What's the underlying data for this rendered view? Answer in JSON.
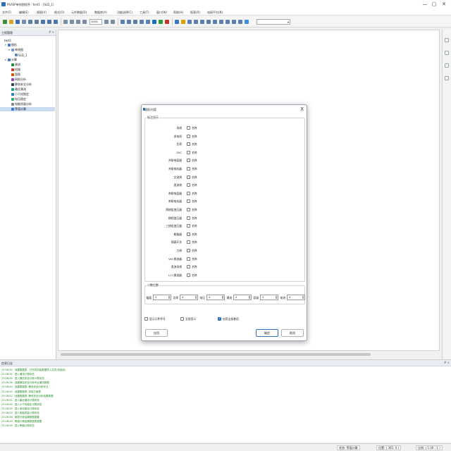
{
  "window": {
    "title": "PSASP单线图程序 - test1 - [SLD_1]",
    "controls": [
      "—",
      "▢",
      "✕"
    ]
  },
  "menu": [
    "文件(F)",
    "编辑(E)",
    "视图(V)",
    "格式(O)",
    "元件数据(D)",
    "数据库(A)",
    "功能选择(C)",
    "工具(T)",
    "窗口(W)",
    "帮助(H)",
    "报表(R)",
    "电网平台(N)"
  ],
  "toolbar": {
    "zoom": "100%"
  },
  "left_panel": {
    "title": "工程管理",
    "pin": "# ×",
    "tree": [
      {
        "label": "test1",
        "level": 0,
        "toggle": "",
        "icon": ""
      },
      {
        "label": "图形",
        "level": 1,
        "toggle": "▾",
        "icon": "#3a7bd5"
      },
      {
        "label": "单线图",
        "level": 2,
        "toggle": "▾",
        "icon": "#6c9bd2"
      },
      {
        "label": "SLD_1",
        "level": 3,
        "toggle": "",
        "icon": "#5a86b8"
      },
      {
        "label": "计算",
        "level": 1,
        "toggle": "▾",
        "icon": "#3a7bd5"
      },
      {
        "label": "潮流",
        "level": 2,
        "toggle": "",
        "icon": "#1c8f3a"
      },
      {
        "label": "短路",
        "level": 2,
        "toggle": "",
        "icon": "#c0392b"
      },
      {
        "label": "暂稳",
        "level": 2,
        "toggle": "",
        "icon": "#d35400"
      },
      {
        "label": "网损分析",
        "level": 2,
        "toggle": "",
        "icon": "#8e44ad"
      },
      {
        "label": "静态安全分析",
        "level": 2,
        "toggle": "",
        "icon": "#2c3e50"
      },
      {
        "label": "最优潮流",
        "level": 2,
        "toggle": "",
        "icon": "#16a085"
      },
      {
        "label": "小干扰稳定",
        "level": 2,
        "toggle": "",
        "icon": "#2980b9"
      },
      {
        "label": "电压稳定",
        "level": 2,
        "toggle": "",
        "icon": "#27ae60"
      },
      {
        "label": "电能质量分析",
        "level": 2,
        "toggle": "",
        "icon": "#7f8c8d"
      },
      {
        "label": "等值计算",
        "level": 2,
        "toggle": "",
        "icon": "#3a7bd5",
        "selected": true
      }
    ]
  },
  "bottom_panel": {
    "title": "信息日志",
    "pin": "# ×",
    "lines": [
      {
        "time": "23:26:30",
        "msg": "创建数据表 - 已先将初始数据导入文件(初始化)"
      },
      {
        "time": "23:26:32",
        "msg": "进入潮流计算状态"
      },
      {
        "time": "23:26:35",
        "msg": "进入静态安全分析计算状态"
      },
      {
        "time": "23:26:38",
        "msg": "创建静态安全分析专业潮流数据"
      },
      {
        "time": "23:26:40",
        "msg": "创建数据表: 静态安全分析作业"
      },
      {
        "time": "23:26:40",
        "msg": "创建数据表: 切除方案表"
      },
      {
        "time": "23:26:40",
        "msg": "创建数据表: 静态安全分析结果数据"
      },
      {
        "time": "23:26:41",
        "msg": "进入最优潮流计算状态"
      },
      {
        "time": "23:26:44",
        "msg": "进入小干扰稳定计算状态"
      },
      {
        "time": "23:26:45",
        "msg": "进入电压稳定计算状态"
      },
      {
        "time": "23:26:45",
        "msg": "进入电能质量计算状态"
      },
      {
        "time": "23:26:46",
        "msg": "网损分析结果数据重置"
      },
      {
        "time": "23:26:49",
        "msg": "等值计算结果数据表重置"
      },
      {
        "time": "23:26:49",
        "msg": "进入等值计算状态"
      }
    ]
  },
  "status_bar": {
    "state": "状态: 等值计算",
    "position": "位置: ( 365, 0 )",
    "scale": "比例: ( 1.00 : 1 )"
  },
  "dialog": {
    "title": "图形内容",
    "close": "X",
    "group_label": "标注显示",
    "checkbox_text": "名称",
    "rows": [
      "母线",
      "发电机",
      "负荷",
      "SVC",
      "并联电容器",
      "并联电抗器",
      "交流线",
      "直流线",
      "串联电容器",
      "串联电抗器",
      "两绕组变压器",
      "移相变压器",
      "三绕组变压器",
      "断路器",
      "隔离开关",
      "刀闸",
      "VSC换流器",
      "直流母线",
      "LCC换流器"
    ],
    "decimal_group_label": "小数位数",
    "decimals": [
      {
        "label": "幅值",
        "value": "4"
      },
      {
        "label": "功率",
        "value": "4"
      },
      {
        "label": "电压",
        "value": "4"
      },
      {
        "label": "潮流",
        "value": "4"
      },
      {
        "label": "容量",
        "value": "4"
      },
      {
        "label": "电流",
        "value": "4"
      }
    ],
    "options": [
      {
        "label": "显示元件序号",
        "checked": false
      },
      {
        "label": "全部显示",
        "checked": false
      },
      {
        "label": "启用全部套用",
        "checked": true
      }
    ],
    "apply_label": "应用",
    "ok_label": "确定",
    "cancel_label": "取消"
  }
}
